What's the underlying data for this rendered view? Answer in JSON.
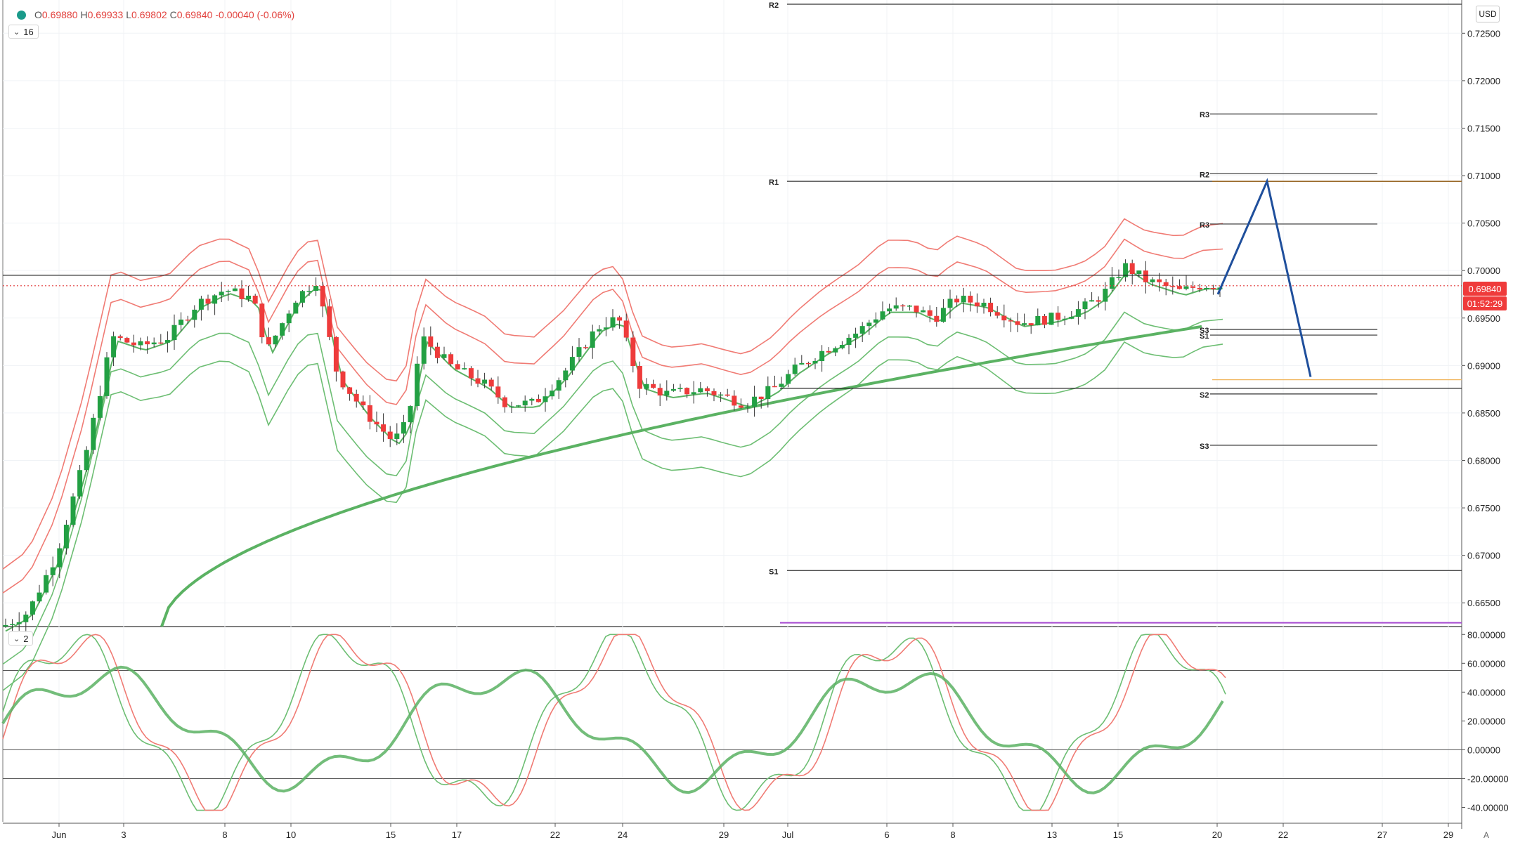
{
  "header": {
    "open_label": "O",
    "open": "0.69880",
    "high_label": "H",
    "high": "0.69933",
    "low_label": "L",
    "low": "0.69802",
    "close_label": "C",
    "close": "0.69840",
    "change": "-0.00040 (-0.06%)"
  },
  "main_legend": {
    "value": "16"
  },
  "osc_legend": {
    "value": "2"
  },
  "currency": "USD",
  "auto_label": "A",
  "price_tags": {
    "last_price": "0.69840",
    "countdown": "01:52:29"
  },
  "colors": {
    "up": "#22a043",
    "down": "#ee3b3b",
    "band_red": "#f07b74",
    "band_green": "#6dbe73",
    "ma_red": "#f06b6b",
    "ma_green": "#5bb263",
    "projection": "#1f4f9c",
    "purple": "#a64ad0",
    "orange": "#f0b45a"
  },
  "chart_data": [
    {
      "type": "candlestick",
      "ylim": [
        0.6625,
        0.7285
      ],
      "y_ticks": [
        "0.72500",
        "0.72000",
        "0.71500",
        "0.71000",
        "0.70500",
        "0.70000",
        "0.69500",
        "0.69000",
        "0.68500",
        "0.68000",
        "0.67500",
        "0.67000",
        "0.66500"
      ],
      "x_ticks": [
        "Jun",
        "3",
        "8",
        "10",
        "15",
        "17",
        "22",
        "24",
        "29",
        "Jul",
        "6",
        "8",
        "13",
        "15",
        "20",
        "22",
        "27",
        "29"
      ],
      "pivot_levels_long": [
        {
          "label": "R2",
          "value": 0.7285
        },
        {
          "label": "R1",
          "value": 0.7094
        },
        {
          "label": "S1",
          "value": 0.6684
        }
      ],
      "pivot_levels_short": [
        {
          "label": "R3",
          "value": 0.7165
        },
        {
          "label": "R2",
          "value": 0.7102
        },
        {
          "label": "R3",
          "value": 0.7049
        },
        {
          "label": "S3",
          "value": 0.6938
        },
        {
          "label": "S1",
          "value": 0.6932
        },
        {
          "label": "S2",
          "value": 0.687
        },
        {
          "label": "S3",
          "value": 0.6816
        }
      ],
      "horizontal_lines": [
        {
          "value": 0.6995,
          "kind": "solid"
        },
        {
          "value": 0.6984,
          "kind": "dotted-red"
        },
        {
          "value": 0.6876,
          "kind": "solid"
        },
        {
          "value": 0.6885,
          "kind": "orange"
        },
        {
          "value": 0.6629,
          "kind": "purple"
        }
      ],
      "projection_path": [
        [
          0,
          0.6975
        ],
        [
          1,
          0.7094
        ],
        [
          2,
          0.6888
        ]
      ],
      "last_price": 0.6984,
      "band_start": 0.6723,
      "band_end": 0.6994,
      "trend_ma": {
        "start": 0.6625,
        "end": 0.6941
      }
    },
    {
      "type": "line",
      "series": [
        {
          "name": "",
          "range": [
            -40,
            80
          ]
        }
      ],
      "ylim": [
        -50,
        85
      ],
      "y_ticks": [
        "80.00000",
        "60.00000",
        "40.00000",
        "20.00000",
        "0.00000",
        "-20.00000",
        "-40.00000"
      ],
      "levels": [
        55,
        0,
        -20
      ]
    }
  ]
}
